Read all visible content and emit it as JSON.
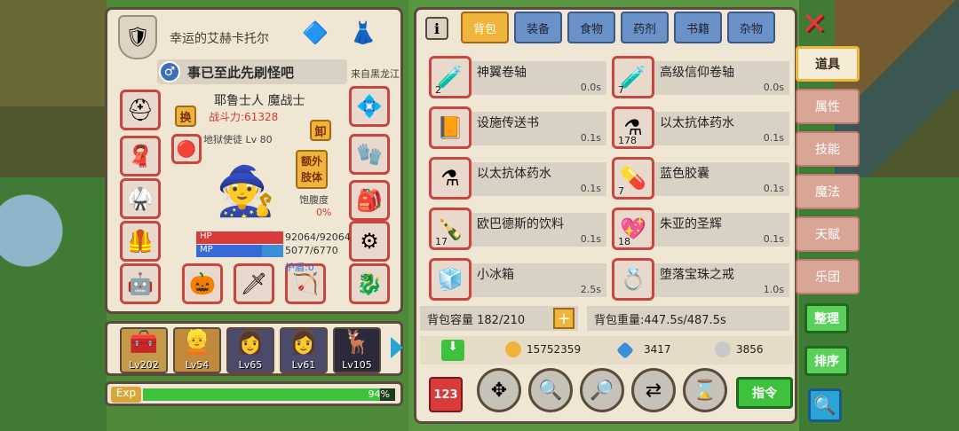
{
  "character": {
    "name": "幸运的艾赫卡托尔",
    "title": "事已至此先刷怪吧",
    "from": "来自黑龙江",
    "class": "耶鲁士人 魔战士",
    "power_label": "战斗力:61328",
    "rank_line": "A阶 地狱使徒 Lv 80",
    "swap_label": "换",
    "unequip_label": "卸",
    "extra_label": "额外肢体",
    "satiety_label": "饱腹度",
    "satiety_value": "0%",
    "hp_label": "HP",
    "mp_label": "MP",
    "hp_text": "92064/92064",
    "mp_text": "5077/6770",
    "mp_fraction": 0.75,
    "shield_text": "护盾:0"
  },
  "party": [
    {
      "level": "Lv202"
    },
    {
      "level": "Lv54"
    },
    {
      "level": "Lv65"
    },
    {
      "level": "Lv61"
    },
    {
      "level": "Lv105"
    }
  ],
  "exp": {
    "label": "Exp",
    "percent_text": "94%",
    "fraction": 0.94
  },
  "tabs": [
    "背包",
    "装备",
    "食物",
    "药剂",
    "书籍",
    "杂物"
  ],
  "items": [
    {
      "name": "神翼卷轴",
      "count": "2",
      "weight": "0.0s",
      "icon": "🧪"
    },
    {
      "name": "高级信仰卷轴",
      "count": "7",
      "weight": "0.0s",
      "icon": "🧪"
    },
    {
      "name": "设施传送书",
      "count": "",
      "weight": "0.1s",
      "icon": "📙"
    },
    {
      "name": "以太抗体药水",
      "count": "178",
      "weight": "0.1s",
      "icon": "⚗"
    },
    {
      "name": "以太抗体药水",
      "count": "",
      "weight": "0.1s",
      "icon": "⚗"
    },
    {
      "name": "蓝色胶囊",
      "count": "7",
      "weight": "0.1s",
      "icon": "💊"
    },
    {
      "name": "欧巴德斯的饮料",
      "count": "17",
      "weight": "0.1s",
      "icon": "🍾"
    },
    {
      "name": "朱亚的圣辉",
      "count": "18",
      "weight": "0.1s",
      "icon": "💖"
    },
    {
      "name": "小冰箱",
      "count": "",
      "weight": "2.5s",
      "icon": "🧊"
    },
    {
      "name": "堕落宝珠之戒",
      "count": "",
      "weight": "1.0s",
      "icon": "💍"
    }
  ],
  "capacity": "背包容量 182/210",
  "weight": "背包重量:447.5s/487.5s",
  "currency": {
    "gold": "15752359",
    "gems": "3417",
    "silver": "3856"
  },
  "command_label": "指令",
  "side_tabs": [
    "道具",
    "属性",
    "技能",
    "魔法",
    "天赋",
    "乐团"
  ],
  "organize_label": "整理",
  "sort_label": "排序",
  "sort123_label": "123"
}
